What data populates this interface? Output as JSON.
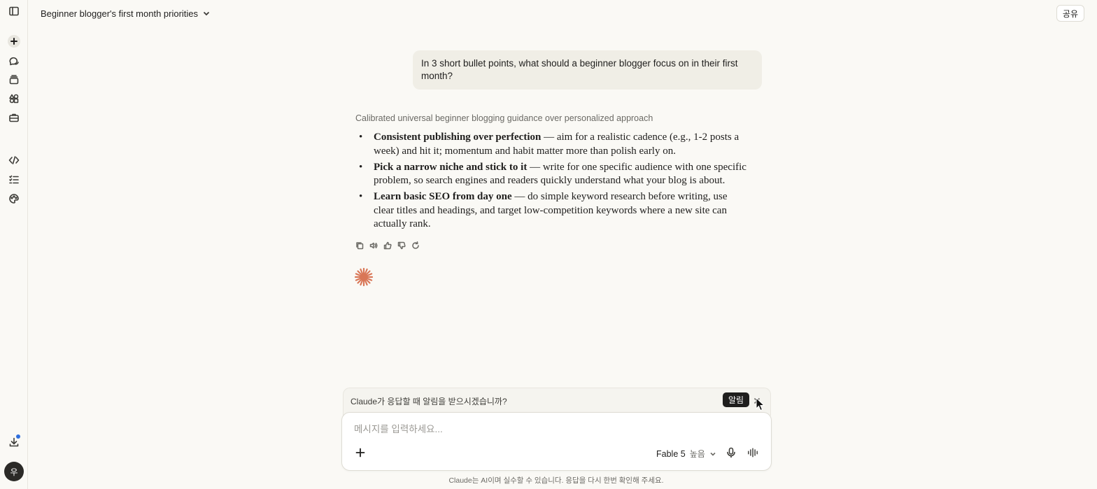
{
  "header": {
    "title": "Beginner blogger's first month priorities",
    "share_label": "공유"
  },
  "sidebar": {
    "items": [
      {
        "name": "toggle-sidebar",
        "icon": "sidebar-icon"
      },
      {
        "name": "new-chat",
        "icon": "plus-icon"
      },
      {
        "name": "chats",
        "icon": "chat-icon"
      },
      {
        "name": "projects",
        "icon": "stack-icon"
      },
      {
        "name": "artifacts",
        "icon": "shapes-icon"
      },
      {
        "name": "tools",
        "icon": "briefcase-icon"
      },
      {
        "name": "code",
        "icon": "code-icon"
      },
      {
        "name": "tasks",
        "icon": "list-icon"
      },
      {
        "name": "styles",
        "icon": "palette-icon"
      }
    ],
    "download_icon": "download-icon",
    "avatar_initial": "우"
  },
  "conversation": {
    "user_message": "In 3 short bullet points, what should a beginner blogger focus on in their first month?",
    "thinking_summary": "Calibrated universal beginner blogging guidance over personalized approach",
    "bullets": [
      {
        "bold": "Consistent publishing over perfection",
        "text": " — aim for a realistic cadence (e.g., 1-2 posts a week) and hit it; momentum and habit matter more than polish early on."
      },
      {
        "bold": "Pick a narrow niche and stick to it",
        "text": " — write for one specific audience with one specific problem, so search engines and readers quickly understand what your blog is about."
      },
      {
        "bold": "Learn basic SEO from day one",
        "text": " — do simple keyword research before writing, use clear titles and headings, and target low-competition keywords where a new site can actually rank."
      }
    ],
    "actions": [
      "copy-icon",
      "speaker-icon",
      "thumbs-up-icon",
      "thumbs-down-icon",
      "retry-icon"
    ]
  },
  "notification": {
    "text": "Claude가 응답할 때 알림을 받으시겠습니까?",
    "button_label": "알림"
  },
  "composer": {
    "placeholder": "메시지를 입력하세요...",
    "model_name": "Fable 5",
    "model_level": "높음"
  },
  "footer": {
    "disclaimer": "Claude는 AI이며 실수할 수 있습니다. 응답을 다시 한번 확인해 주세요."
  },
  "colors": {
    "background": "#faf9f5",
    "accent_spark": "#d97757",
    "user_bubble": "#f0eee6",
    "notif_dot": "#2f6fde"
  }
}
